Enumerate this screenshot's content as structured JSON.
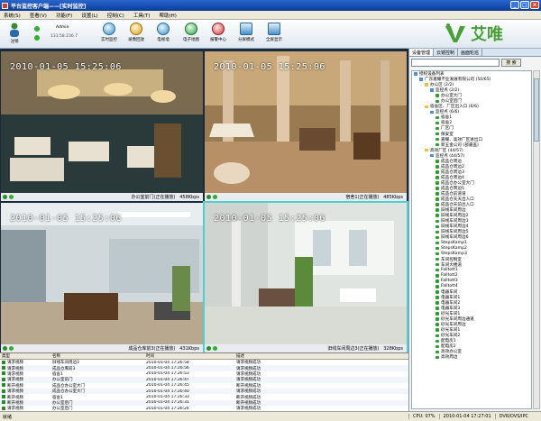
{
  "window": {
    "title": "平台监控客户端——[实时监控]",
    "minimize": "_",
    "maximize": "□",
    "close": "×"
  },
  "menu": [
    "系统(S)",
    "查看(V)",
    "功能(F)",
    "设置(L)",
    "控制(C)",
    "工具(T)",
    "帮助(H)"
  ],
  "toolbar": {
    "user_label": "注销",
    "user_name": "Admin",
    "ip": "131.58.236.7",
    "buttons": [
      "实时监控",
      "录像回放",
      "电视墙",
      "电子地图",
      "报警中心",
      "分屏模式",
      "全屏显示"
    ]
  },
  "brand": {
    "name": "艾唯"
  },
  "panes": [
    {
      "timestamp": "2010-01-05 15:25:06",
      "caption": "办公室前门(正在播放)",
      "rate": "458Kbps"
    },
    {
      "timestamp": "2010-01-05 15:25:06",
      "caption": "宿舍1(正在播放)",
      "rate": "485Kbps"
    },
    {
      "timestamp": "2010-01-05 15:25:06",
      "caption": "成品仓库前3(正在播放)",
      "rate": "431Kbps"
    },
    {
      "timestamp": "2010-01-05 15:25:06",
      "caption": "旧线车间周边3(正在播放)",
      "rate": "328Kbps"
    }
  ],
  "log": {
    "headers": [
      "类型",
      "名称",
      "时间",
      "描述"
    ],
    "rows": [
      [
        "请求视频",
        "旧线车间周边3",
        "2010-01-04 17:26:58",
        "请求视频成功"
      ],
      [
        "请求视频",
        "成品仓库前3",
        "2010-01-04 17:26:56",
        "请求视频成功"
      ],
      [
        "请求视频",
        "宿舍1",
        "2010-01-04 17:26:53",
        "请求视频成功"
      ],
      [
        "请求视频",
        "办公室前门",
        "2010-01-04 17:26:47",
        "请求视频成功"
      ],
      [
        "断开视频",
        "成品仓办公室大门",
        "2010-01-04 17:26:45",
        "断开视频成功"
      ],
      [
        "请求视频",
        "成品仓办公室大门",
        "2010-01-04 17:26:40",
        "请求视频成功"
      ],
      [
        "断开视频",
        "宿舍1",
        "2010-01-04 17:26:33",
        "断开视频成功"
      ],
      [
        "断开视频",
        "办公室后门",
        "2010-01-04 17:26:31",
        "断开视频成功"
      ],
      [
        "请求视频",
        "办公室后门",
        "2010-01-04 17:26:24",
        "请求视频成功"
      ]
    ]
  },
  "right_panel": {
    "tabs": [
      "设备管理",
      "云镜控制",
      "画面轮巡"
    ],
    "search_button": "搜 索",
    "tree": [
      {
        "t": "grp",
        "d": 0,
        "label": "授权设备列表"
      },
      {
        "t": "grp",
        "d": 1,
        "label": "广东嘉耀不业发展有限公司 (50/65)"
      },
      {
        "t": "fld",
        "d": 2,
        "label": "办公区 (2/2)"
      },
      {
        "t": "grp",
        "d": 3,
        "label": "监控点 (2/2)"
      },
      {
        "t": "cam",
        "d": 4,
        "label": "办公室大门"
      },
      {
        "t": "cam",
        "d": 4,
        "label": "办公室后门"
      },
      {
        "t": "fld",
        "d": 2,
        "label": "宿舍区、厂区出入口 (6/6)"
      },
      {
        "t": "grp",
        "d": 3,
        "label": "监控点 (6/6)"
      },
      {
        "t": "cam",
        "d": 4,
        "label": "宿舍1"
      },
      {
        "t": "cam",
        "d": 4,
        "label": "宿舍2"
      },
      {
        "t": "cam",
        "d": 4,
        "label": "厂区门"
      },
      {
        "t": "cam",
        "d": 4,
        "label": "保安室"
      },
      {
        "t": "cam",
        "d": 4,
        "label": "嘉耀、高效厂区进出口"
      },
      {
        "t": "cam",
        "d": 4,
        "label": "新五金公司 (部嘉盖)"
      },
      {
        "t": "fld",
        "d": 2,
        "label": "高效厂区 (44/57)"
      },
      {
        "t": "grp",
        "d": 3,
        "label": "监控点 (44/57)"
      },
      {
        "t": "cam",
        "d": 4,
        "label": "成品仓周边"
      },
      {
        "t": "cam",
        "d": 4,
        "label": "成品仓周边2"
      },
      {
        "t": "cam",
        "d": 4,
        "label": "成品仓周边3"
      },
      {
        "t": "cam",
        "d": 4,
        "label": "成品仓周边4"
      },
      {
        "t": "cam",
        "d": 4,
        "label": "成品仓办公室大门"
      },
      {
        "t": "cam",
        "d": 4,
        "label": "成品仓周边5"
      },
      {
        "t": "cam",
        "d": 4,
        "label": "成品仓前道道"
      },
      {
        "t": "cam",
        "d": 4,
        "label": "成品仓天天出入口"
      },
      {
        "t": "cam",
        "d": 4,
        "label": "成品仓天前出入口"
      },
      {
        "t": "cam",
        "d": 4,
        "label": "旧线车间周边"
      },
      {
        "t": "cam",
        "d": 4,
        "label": "旧线车间周边2"
      },
      {
        "t": "cam",
        "d": 4,
        "label": "旧线车间周边3"
      },
      {
        "t": "cam",
        "d": 4,
        "label": "旧线车间周边4"
      },
      {
        "t": "cam",
        "d": 4,
        "label": "旧线车间周边5"
      },
      {
        "t": "cam",
        "d": 4,
        "label": "旧线车间周边6"
      },
      {
        "t": "cam",
        "d": 4,
        "label": "StepsKamp1"
      },
      {
        "t": "cam",
        "d": 4,
        "label": "StepsKamp2"
      },
      {
        "t": "cam",
        "d": 4,
        "label": "StepsKamp3"
      },
      {
        "t": "cam",
        "d": 4,
        "label": "车间控制室"
      },
      {
        "t": "cam",
        "d": 4,
        "label": "车间大楼道"
      },
      {
        "t": "cam",
        "d": 4,
        "label": "Falltott1"
      },
      {
        "t": "cam",
        "d": 4,
        "label": "Falltott2"
      },
      {
        "t": "cam",
        "d": 4,
        "label": "Falltott3"
      },
      {
        "t": "cam",
        "d": 4,
        "label": "Falltott4"
      },
      {
        "t": "cam",
        "d": 4,
        "label": "电器车间"
      },
      {
        "t": "cam",
        "d": 4,
        "label": "电器车间1"
      },
      {
        "t": "cam",
        "d": 4,
        "label": "电器车间2"
      },
      {
        "t": "cam",
        "d": 4,
        "label": "电器车间3"
      },
      {
        "t": "cam",
        "d": 4,
        "label": "砂光车间1"
      },
      {
        "t": "cam",
        "d": 4,
        "label": "砂光车间周边通道"
      },
      {
        "t": "cam",
        "d": 4,
        "label": "砂光车间周边"
      },
      {
        "t": "cam",
        "d": 4,
        "label": "砂光车间1"
      },
      {
        "t": "cam",
        "d": 4,
        "label": "砂光车间2"
      },
      {
        "t": "cam",
        "d": 4,
        "label": "配电房1"
      },
      {
        "t": "cam",
        "d": 4,
        "label": "配电房2"
      },
      {
        "t": "cam",
        "d": 4,
        "label": "高效办公室"
      },
      {
        "t": "cam",
        "d": 4,
        "label": "高效周边"
      }
    ]
  },
  "status": {
    "left": "就绪",
    "cpu": "CPU: 07%",
    "time": "2010-01-04 17:27:01",
    "version": "DVR/DVS/IPC"
  },
  "colors": {
    "titlebar": "#0a3c9c",
    "selected_pane": "#4ed0d0",
    "brand": "#4aa038"
  }
}
